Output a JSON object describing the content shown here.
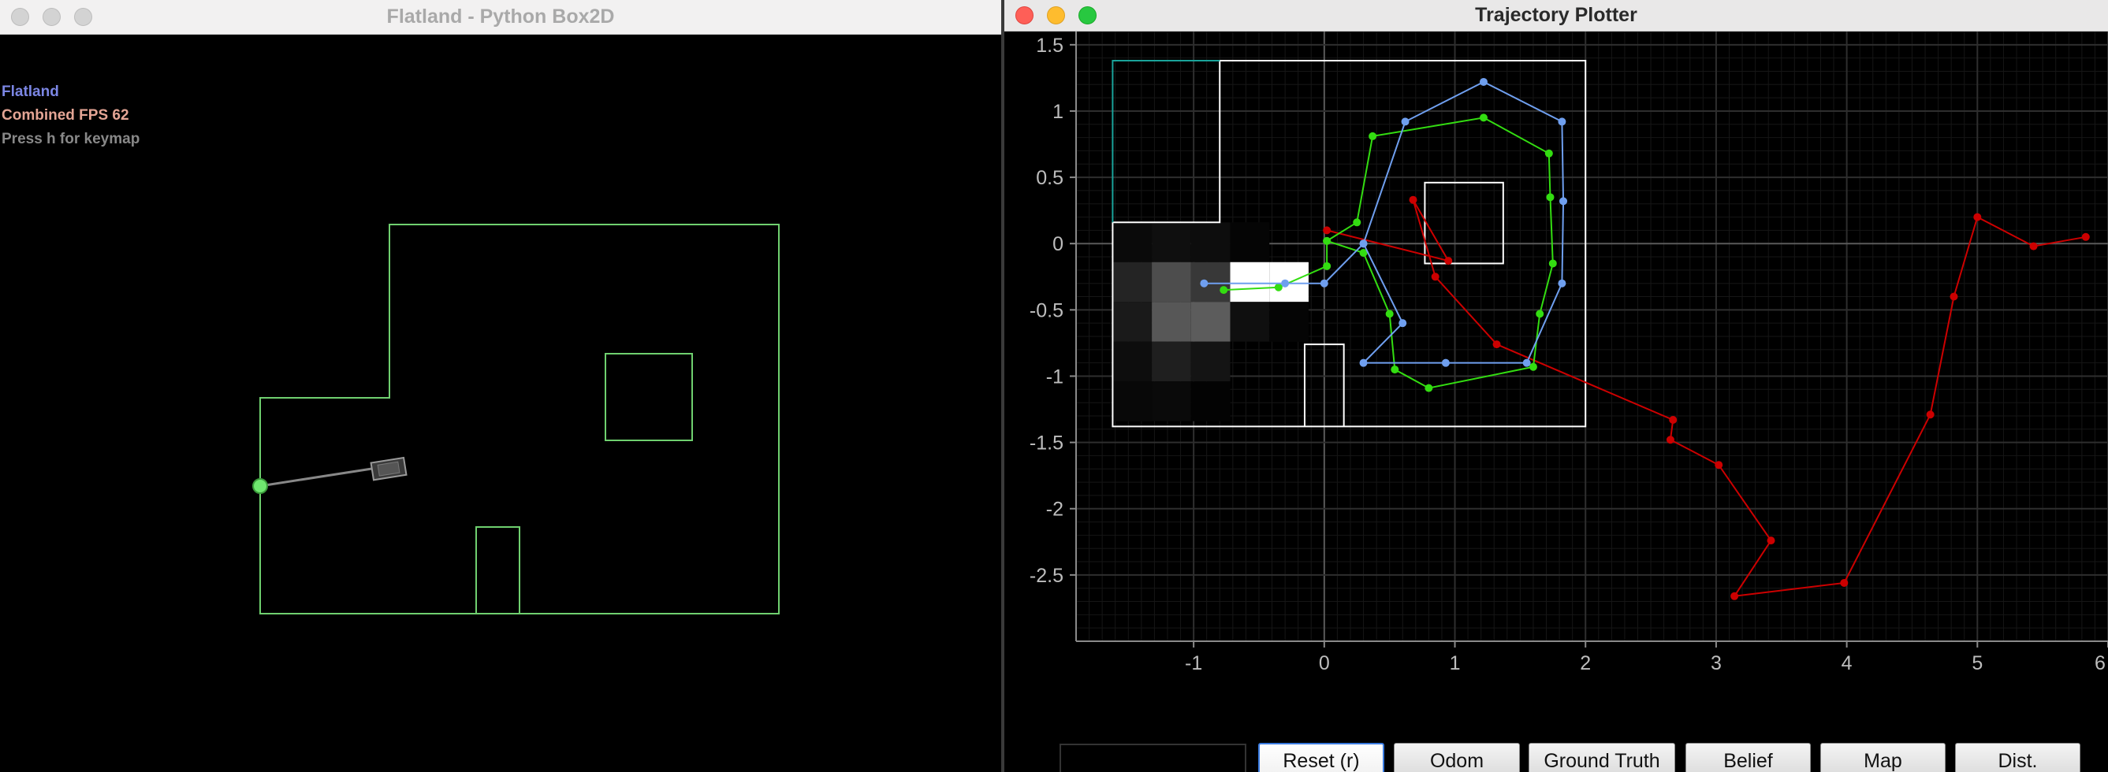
{
  "left_window": {
    "title": "Flatland - Python Box2D",
    "hud": [
      "Flatland",
      "Combined FPS 62",
      "Press h for keymap"
    ]
  },
  "right_window": {
    "title": "Trajectory Plotter",
    "status_field_value": "",
    "buttons": [
      "Reset (r)",
      "Odom",
      "Ground Truth",
      "Belief",
      "Map",
      "Dist."
    ]
  },
  "colors": {
    "world_outline": "#6fd06f",
    "map_outline": "#ffffff",
    "start_cell": "#1aa39a",
    "odom": "#cc0000",
    "ground_truth": "#33dd11",
    "belief": "#6f9fef",
    "grid": "#2e2e2e",
    "axis": "#8a8a8a"
  },
  "chart_data": {
    "type": "line",
    "title": "",
    "xlabel": "",
    "ylabel": "",
    "xlim": [
      -1.9,
      6.0
    ],
    "ylim": [
      -3.0,
      1.6
    ],
    "xticks": [
      -1,
      0,
      1,
      2,
      3,
      4,
      5,
      6
    ],
    "yticks": [
      1.5,
      1,
      0.5,
      0,
      -0.5,
      -1,
      -1.5,
      -2,
      -2.5
    ],
    "grid": true,
    "legend": "none",
    "series": [
      {
        "key": "odom",
        "color": "#cc0000",
        "x": [
          0.02,
          0.95,
          0.68,
          0.85,
          1.32,
          2.67,
          2.65,
          3.02,
          3.42,
          3.14,
          3.98,
          4.64,
          4.82,
          5.0,
          5.43,
          5.83
        ],
        "y": [
          0.1,
          -0.13,
          0.33,
          -0.25,
          -0.76,
          -1.33,
          -1.48,
          -1.67,
          -2.24,
          -2.66,
          -2.56,
          -1.29,
          -0.4,
          0.2,
          -0.02,
          0.05
        ]
      },
      {
        "key": "ground_truth",
        "color": "#33dd11",
        "x": [
          -0.77,
          -0.35,
          0.02,
          0.02,
          0.25,
          0.37,
          1.22,
          1.72,
          1.73,
          1.75,
          1.65,
          1.6,
          0.8,
          0.54,
          0.5,
          0.3,
          0.02
        ],
        "y": [
          -0.35,
          -0.33,
          -0.17,
          0.02,
          0.16,
          0.81,
          0.95,
          0.68,
          0.35,
          -0.15,
          -0.53,
          -0.93,
          -1.09,
          -0.95,
          -0.53,
          -0.07,
          0.02
        ]
      },
      {
        "key": "belief",
        "color": "#6f9fef",
        "x": [
          -0.92,
          -0.3,
          0.0,
          0.3,
          0.62,
          1.22,
          1.82,
          1.83,
          1.82,
          1.55,
          0.93,
          0.3,
          0.6,
          0.3
        ],
        "y": [
          -0.3,
          -0.3,
          -0.3,
          0.0,
          0.92,
          1.22,
          0.92,
          0.32,
          -0.3,
          -0.9,
          -0.9,
          -0.9,
          -0.6,
          0.0
        ]
      }
    ]
  }
}
